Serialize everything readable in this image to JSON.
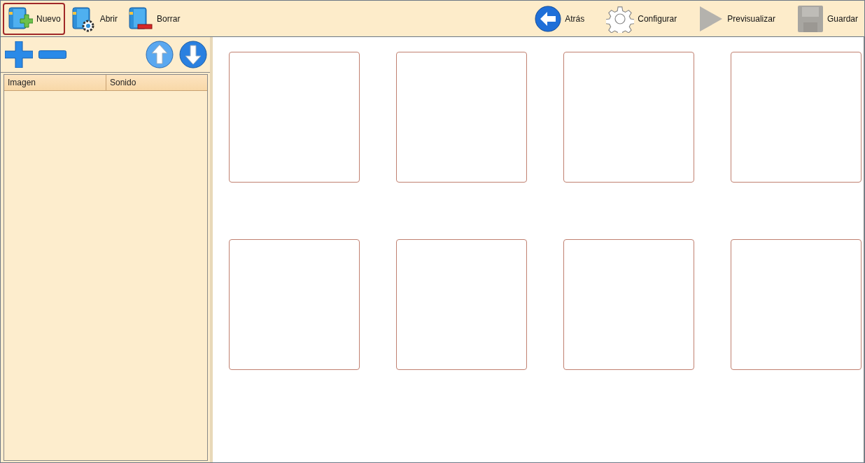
{
  "toolbar": {
    "left": [
      {
        "label": "Nuevo",
        "kind": "new",
        "selected": true,
        "disabled": false
      },
      {
        "label": "Abrir",
        "kind": "open",
        "selected": false,
        "disabled": false
      },
      {
        "label": "Borrar",
        "kind": "delete",
        "selected": false,
        "disabled": false
      }
    ],
    "right": [
      {
        "label": "Atrás",
        "kind": "back",
        "selected": false,
        "disabled": false
      },
      {
        "label": "Configurar",
        "kind": "settings",
        "selected": false,
        "disabled": false
      },
      {
        "label": "Previsualizar",
        "kind": "preview",
        "selected": false,
        "disabled": true
      },
      {
        "label": "Guardar",
        "kind": "save",
        "selected": false,
        "disabled": true
      }
    ]
  },
  "sidebar": {
    "table": {
      "columns": [
        "Imagen",
        "Sonido"
      ]
    }
  }
}
